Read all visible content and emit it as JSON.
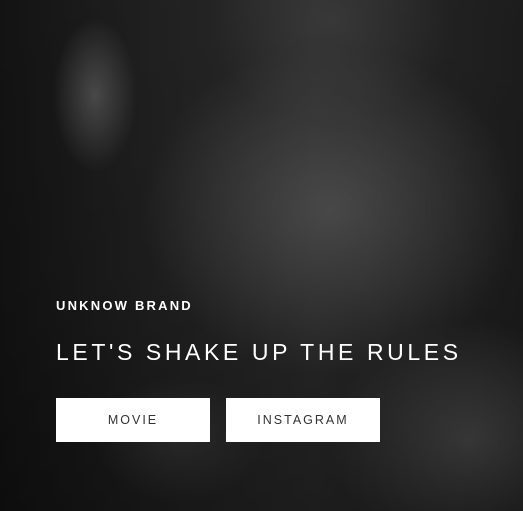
{
  "hero": {
    "brand": "UNKNOW BRAND",
    "headline": "LET'S SHAKE UP THE RULES",
    "buttons": [
      {
        "label": "MOVIE"
      },
      {
        "label": "INSTAGRAM"
      }
    ]
  },
  "colors": {
    "text": "#ffffff",
    "button_bg": "#ffffff",
    "button_text": "#333333"
  }
}
